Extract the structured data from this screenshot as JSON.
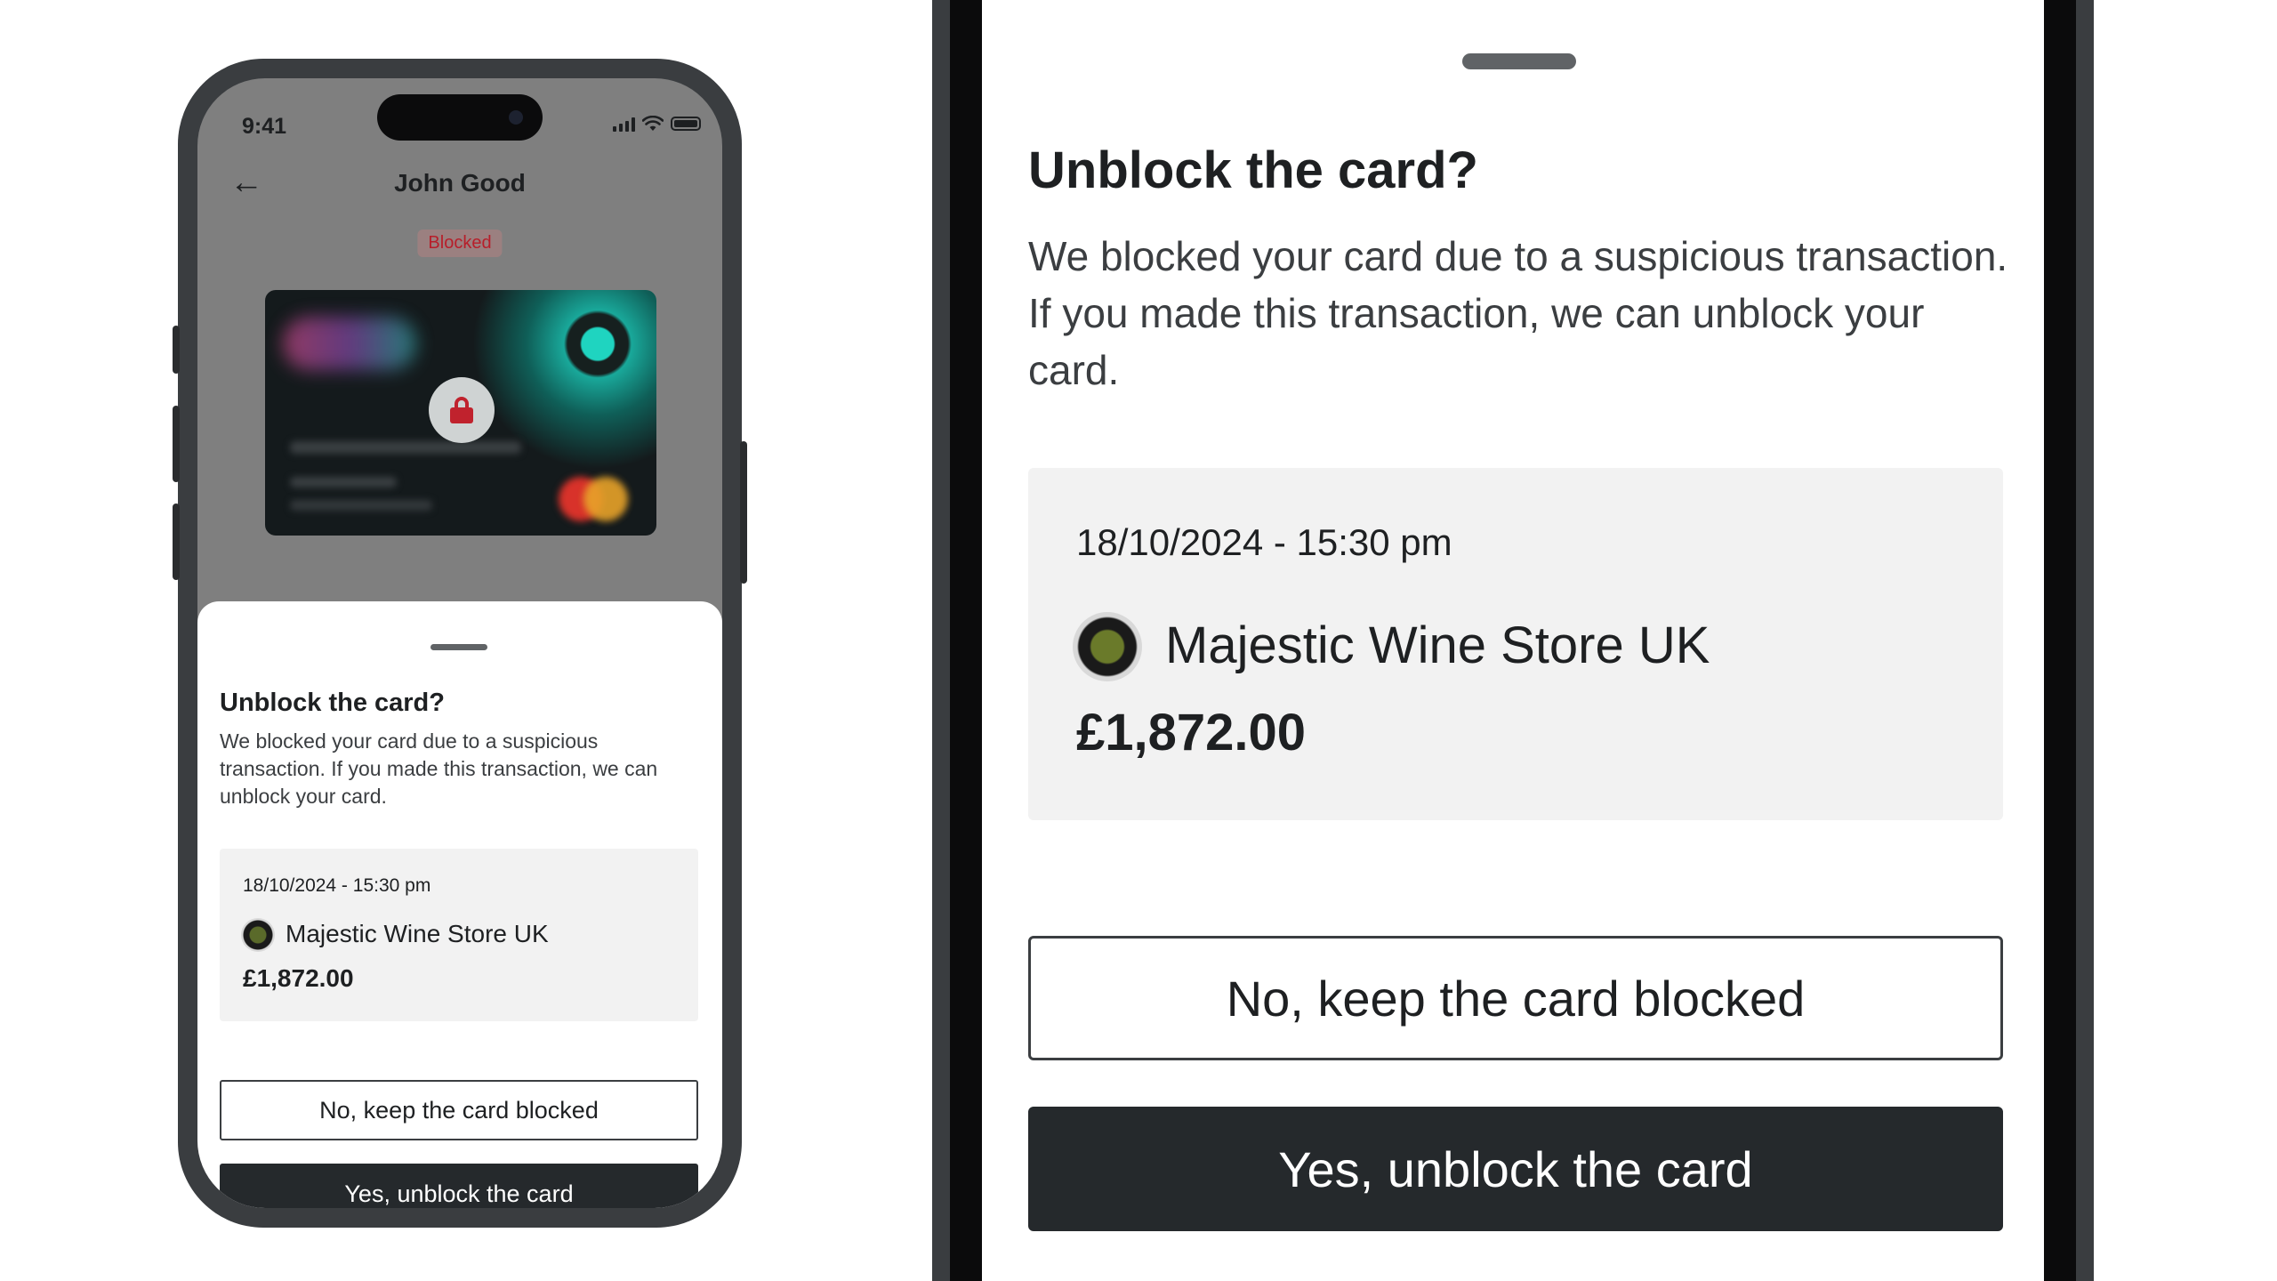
{
  "status_bar": {
    "time": "9:41"
  },
  "header": {
    "title": "John Good",
    "badge": "Blocked"
  },
  "sheet": {
    "title": "Unblock the card?",
    "description": "We blocked your card due to a suspicious transaction. If you made this transaction, we can unblock your card.",
    "transaction": {
      "datetime": "18/10/2024 - 15:30 pm",
      "merchant": "Majestic Wine Store UK",
      "amount": "£1,872.00"
    },
    "buttons": {
      "keep_blocked": "No, keep the card blocked",
      "unblock": "Yes, unblock the card"
    }
  },
  "icons": {
    "back": "arrow-left-icon",
    "lock": "lock-icon",
    "signal": "signal-icon",
    "wifi": "wifi-icon",
    "battery": "battery-icon"
  },
  "colors": {
    "primary_dark": "#25292c",
    "danger": "#c0222d",
    "panel_bg": "#f2f2f2"
  }
}
